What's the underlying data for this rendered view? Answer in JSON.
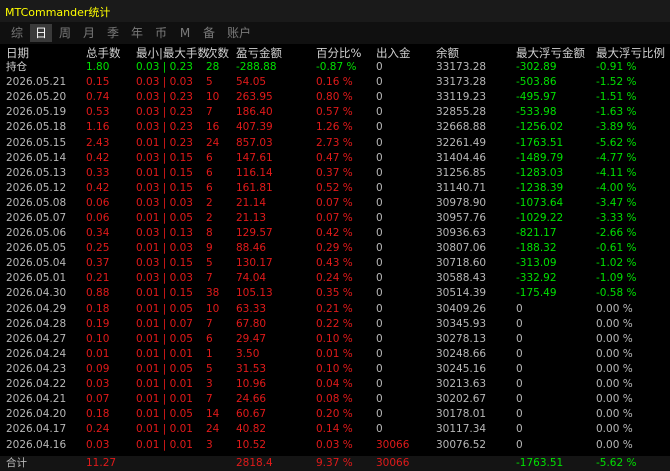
{
  "app_title": "MTCommander统计",
  "tabs": [
    {
      "label": "综",
      "active": false
    },
    {
      "label": "日",
      "active": true
    },
    {
      "label": "周",
      "active": false
    },
    {
      "label": "月",
      "active": false
    },
    {
      "label": "季",
      "active": false
    },
    {
      "label": "年",
      "active": false
    },
    {
      "label": "币",
      "active": false
    },
    {
      "label": "M",
      "active": false
    },
    {
      "label": "备",
      "active": false
    },
    {
      "label": "账户",
      "active": false
    }
  ],
  "columns": [
    "日期",
    "总手数",
    "最小|最大手数",
    "次数",
    "盈亏金额",
    "百分比%",
    "出入金",
    "余额",
    "最大浮亏金额",
    "最大浮亏比例"
  ],
  "colors": {
    "profit": "#00e000",
    "loss": "#e11a1a",
    "title": "#ffff00",
    "neutral": "#b8b8b8"
  },
  "holding": {
    "date": "持仓",
    "lots": "1.80",
    "minmax": "0.03 | 0.23",
    "count": "28",
    "pnl": "-288.88",
    "pct": "-0.87 %",
    "io": "0",
    "balance": "33173.28",
    "dd_amount": "-302.89",
    "dd_pct": "-0.91 %",
    "tone": "green"
  },
  "rows": [
    {
      "date": "2026.05.21",
      "lots": "0.15",
      "minmax": "0.03 | 0.03",
      "count": "5",
      "pnl": "54.05",
      "pct": "0.16 %",
      "io": "0",
      "balance": "33173.28",
      "dd_amount": "-503.86",
      "dd_pct": "-1.52 %"
    },
    {
      "date": "2026.05.20",
      "lots": "0.74",
      "minmax": "0.03 | 0.23",
      "count": "10",
      "pnl": "263.95",
      "pct": "0.80 %",
      "io": "0",
      "balance": "33119.23",
      "dd_amount": "-495.97",
      "dd_pct": "-1.51 %"
    },
    {
      "date": "2026.05.19",
      "lots": "0.53",
      "minmax": "0.03 | 0.23",
      "count": "7",
      "pnl": "186.40",
      "pct": "0.57 %",
      "io": "0",
      "balance": "32855.28",
      "dd_amount": "-533.98",
      "dd_pct": "-1.63 %"
    },
    {
      "date": "2026.05.18",
      "lots": "1.16",
      "minmax": "0.03 | 0.23",
      "count": "16",
      "pnl": "407.39",
      "pct": "1.26 %",
      "io": "0",
      "balance": "32668.88",
      "dd_amount": "-1256.02",
      "dd_pct": "-3.89 %"
    },
    {
      "date": "2026.05.15",
      "lots": "2.43",
      "minmax": "0.01 | 0.23",
      "count": "24",
      "pnl": "857.03",
      "pct": "2.73 %",
      "io": "0",
      "balance": "32261.49",
      "dd_amount": "-1763.51",
      "dd_pct": "-5.62 %"
    },
    {
      "date": "2026.05.14",
      "lots": "0.42",
      "minmax": "0.03 | 0.15",
      "count": "6",
      "pnl": "147.61",
      "pct": "0.47 %",
      "io": "0",
      "balance": "31404.46",
      "dd_amount": "-1489.79",
      "dd_pct": "-4.77 %"
    },
    {
      "date": "2026.05.13",
      "lots": "0.33",
      "minmax": "0.01 | 0.15",
      "count": "6",
      "pnl": "116.14",
      "pct": "0.37 %",
      "io": "0",
      "balance": "31256.85",
      "dd_amount": "-1283.03",
      "dd_pct": "-4.11 %"
    },
    {
      "date": "2026.05.12",
      "lots": "0.42",
      "minmax": "0.03 | 0.15",
      "count": "6",
      "pnl": "161.81",
      "pct": "0.52 %",
      "io": "0",
      "balance": "31140.71",
      "dd_amount": "-1238.39",
      "dd_pct": "-4.00 %"
    },
    {
      "date": "2026.05.08",
      "lots": "0.06",
      "minmax": "0.03 | 0.03",
      "count": "2",
      "pnl": "21.14",
      "pct": "0.07 %",
      "io": "0",
      "balance": "30978.90",
      "dd_amount": "-1073.64",
      "dd_pct": "-3.47 %"
    },
    {
      "date": "2026.05.07",
      "lots": "0.06",
      "minmax": "0.01 | 0.05",
      "count": "2",
      "pnl": "21.13",
      "pct": "0.07 %",
      "io": "0",
      "balance": "30957.76",
      "dd_amount": "-1029.22",
      "dd_pct": "-3.33 %"
    },
    {
      "date": "2026.05.06",
      "lots": "0.34",
      "minmax": "0.03 | 0.13",
      "count": "8",
      "pnl": "129.57",
      "pct": "0.42 %",
      "io": "0",
      "balance": "30936.63",
      "dd_amount": "-821.17",
      "dd_pct": "-2.66 %"
    },
    {
      "date": "2026.05.05",
      "lots": "0.25",
      "minmax": "0.01 | 0.03",
      "count": "9",
      "pnl": "88.46",
      "pct": "0.29 %",
      "io": "0",
      "balance": "30807.06",
      "dd_amount": "-188.32",
      "dd_pct": "-0.61 %"
    },
    {
      "date": "2026.05.04",
      "lots": "0.37",
      "minmax": "0.03 | 0.15",
      "count": "5",
      "pnl": "130.17",
      "pct": "0.43 %",
      "io": "0",
      "balance": "30718.60",
      "dd_amount": "-313.09",
      "dd_pct": "-1.02 %"
    },
    {
      "date": "2026.05.01",
      "lots": "0.21",
      "minmax": "0.03 | 0.03",
      "count": "7",
      "pnl": "74.04",
      "pct": "0.24 %",
      "io": "0",
      "balance": "30588.43",
      "dd_amount": "-332.92",
      "dd_pct": "-1.09 %"
    },
    {
      "date": "2026.04.30",
      "lots": "0.88",
      "minmax": "0.01 | 0.15",
      "count": "38",
      "pnl": "105.13",
      "pct": "0.35 %",
      "io": "0",
      "balance": "30514.39",
      "dd_amount": "-175.49",
      "dd_pct": "-0.58 %"
    },
    {
      "date": "2026.04.29",
      "lots": "0.18",
      "minmax": "0.01 | 0.05",
      "count": "10",
      "pnl": "63.33",
      "pct": "0.21 %",
      "io": "0",
      "balance": "30409.26",
      "dd_amount": "0",
      "dd_pct": "0.00 %"
    },
    {
      "date": "2026.04.28",
      "lots": "0.19",
      "minmax": "0.01 | 0.07",
      "count": "7",
      "pnl": "67.80",
      "pct": "0.22 %",
      "io": "0",
      "balance": "30345.93",
      "dd_amount": "0",
      "dd_pct": "0.00 %"
    },
    {
      "date": "2026.04.27",
      "lots": "0.10",
      "minmax": "0.01 | 0.05",
      "count": "6",
      "pnl": "29.47",
      "pct": "0.10 %",
      "io": "0",
      "balance": "30278.13",
      "dd_amount": "0",
      "dd_pct": "0.00 %"
    },
    {
      "date": "2026.04.24",
      "lots": "0.01",
      "minmax": "0.01 | 0.01",
      "count": "1",
      "pnl": "3.50",
      "pct": "0.01 %",
      "io": "0",
      "balance": "30248.66",
      "dd_amount": "0",
      "dd_pct": "0.00 %"
    },
    {
      "date": "2026.04.23",
      "lots": "0.09",
      "minmax": "0.01 | 0.05",
      "count": "5",
      "pnl": "31.53",
      "pct": "0.10 %",
      "io": "0",
      "balance": "30245.16",
      "dd_amount": "0",
      "dd_pct": "0.00 %"
    },
    {
      "date": "2026.04.22",
      "lots": "0.03",
      "minmax": "0.01 | 0.01",
      "count": "3",
      "pnl": "10.96",
      "pct": "0.04 %",
      "io": "0",
      "balance": "30213.63",
      "dd_amount": "0",
      "dd_pct": "0.00 %"
    },
    {
      "date": "2026.04.21",
      "lots": "0.07",
      "minmax": "0.01 | 0.01",
      "count": "7",
      "pnl": "24.66",
      "pct": "0.08 %",
      "io": "0",
      "balance": "30202.67",
      "dd_amount": "0",
      "dd_pct": "0.00 %"
    },
    {
      "date": "2026.04.20",
      "lots": "0.18",
      "minmax": "0.01 | 0.05",
      "count": "14",
      "pnl": "60.67",
      "pct": "0.20 %",
      "io": "0",
      "balance": "30178.01",
      "dd_amount": "0",
      "dd_pct": "0.00 %"
    },
    {
      "date": "2026.04.17",
      "lots": "0.24",
      "minmax": "0.01 | 0.01",
      "count": "24",
      "pnl": "40.82",
      "pct": "0.14 %",
      "io": "0",
      "balance": "30117.34",
      "dd_amount": "0",
      "dd_pct": "0.00 %"
    },
    {
      "date": "2026.04.16",
      "lots": "0.03",
      "minmax": "0.01 | 0.01",
      "count": "3",
      "pnl": "10.52",
      "pct": "0.03 %",
      "io": "30066",
      "balance": "30076.52",
      "dd_amount": "0",
      "dd_pct": "0.00 %"
    }
  ],
  "total": {
    "date": "合计",
    "lots": "11.27",
    "minmax": "",
    "count": "",
    "pnl": "2818.4",
    "pct": "9.37 %",
    "io": "30066",
    "balance": "",
    "dd_amount": "-1763.51",
    "dd_pct": "-5.62 %"
  }
}
